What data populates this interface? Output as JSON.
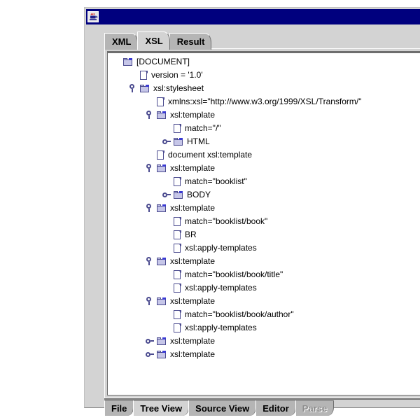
{
  "window": {
    "title": "",
    "icon": "java-coffee-cup-icon"
  },
  "top_tabs": [
    {
      "label": "XML",
      "selected": false
    },
    {
      "label": "XSL",
      "selected": true
    },
    {
      "label": "Result",
      "selected": false
    }
  ],
  "bottom_tabs": [
    {
      "label": "File",
      "selected": false,
      "disabled": false
    },
    {
      "label": "Tree View",
      "selected": true,
      "disabled": false
    },
    {
      "label": "Source View",
      "selected": false,
      "disabled": false
    },
    {
      "label": "Editor",
      "selected": false,
      "disabled": false
    },
    {
      "label": "Parse",
      "selected": false,
      "disabled": true
    }
  ],
  "tree": {
    "rows": [
      {
        "label": "[DOCUMENT]",
        "indent": 0,
        "icon": "folder-icon",
        "handle": "none"
      },
      {
        "label": "version = '1.0'",
        "indent": 1,
        "icon": "document-icon",
        "handle": "none"
      },
      {
        "label": "xsl:stylesheet",
        "indent": 1,
        "icon": "folder-icon",
        "handle": "expanded"
      },
      {
        "label": "xmlns:xsl=\"http://www.w3.org/1999/XSL/Transform/\"",
        "indent": 2,
        "icon": "document-icon",
        "handle": "none"
      },
      {
        "label": "xsl:template",
        "indent": 2,
        "icon": "folder-icon",
        "handle": "expanded"
      },
      {
        "label": "match=\"/\"",
        "indent": 3,
        "icon": "document-icon",
        "handle": "none"
      },
      {
        "label": "HTML",
        "indent": 3,
        "icon": "folder-icon",
        "handle": "collapsed"
      },
      {
        "label": "document xsl:template",
        "indent": 2,
        "icon": "document-icon",
        "handle": "none"
      },
      {
        "label": "xsl:template",
        "indent": 2,
        "icon": "folder-icon",
        "handle": "expanded"
      },
      {
        "label": "match=\"booklist\"",
        "indent": 3,
        "icon": "document-icon",
        "handle": "none"
      },
      {
        "label": "BODY",
        "indent": 3,
        "icon": "folder-icon",
        "handle": "collapsed"
      },
      {
        "label": "xsl:template",
        "indent": 2,
        "icon": "folder-icon",
        "handle": "expanded"
      },
      {
        "label": "match=\"booklist/book\"",
        "indent": 3,
        "icon": "document-icon",
        "handle": "none"
      },
      {
        "label": "BR",
        "indent": 3,
        "icon": "document-icon",
        "handle": "none"
      },
      {
        "label": "xsl:apply-templates",
        "indent": 3,
        "icon": "document-icon",
        "handle": "none"
      },
      {
        "label": "xsl:template",
        "indent": 2,
        "icon": "folder-icon",
        "handle": "expanded"
      },
      {
        "label": "match=\"booklist/book/title\"",
        "indent": 3,
        "icon": "document-icon",
        "handle": "none"
      },
      {
        "label": "xsl:apply-templates",
        "indent": 3,
        "icon": "document-icon",
        "handle": "none"
      },
      {
        "label": "xsl:template",
        "indent": 2,
        "icon": "folder-icon",
        "handle": "expanded"
      },
      {
        "label": "match=\"booklist/book/author\"",
        "indent": 3,
        "icon": "document-icon",
        "handle": "none"
      },
      {
        "label": "xsl:apply-templates",
        "indent": 3,
        "icon": "document-icon",
        "handle": "none"
      },
      {
        "label": "xsl:template",
        "indent": 2,
        "icon": "folder-icon",
        "handle": "collapsed"
      },
      {
        "label": "xsl:template",
        "indent": 2,
        "icon": "folder-icon",
        "handle": "collapsed"
      }
    ]
  },
  "colors": {
    "titlebar": "#00007e",
    "frame": "#d3d3d3",
    "tab_unselected": "#b5b5b5",
    "tree_background": "#ffffff",
    "icon_outline": "#4b4b8f",
    "folder_fill": "#c6c6e8",
    "disabled_text": "#8c8c8c"
  }
}
